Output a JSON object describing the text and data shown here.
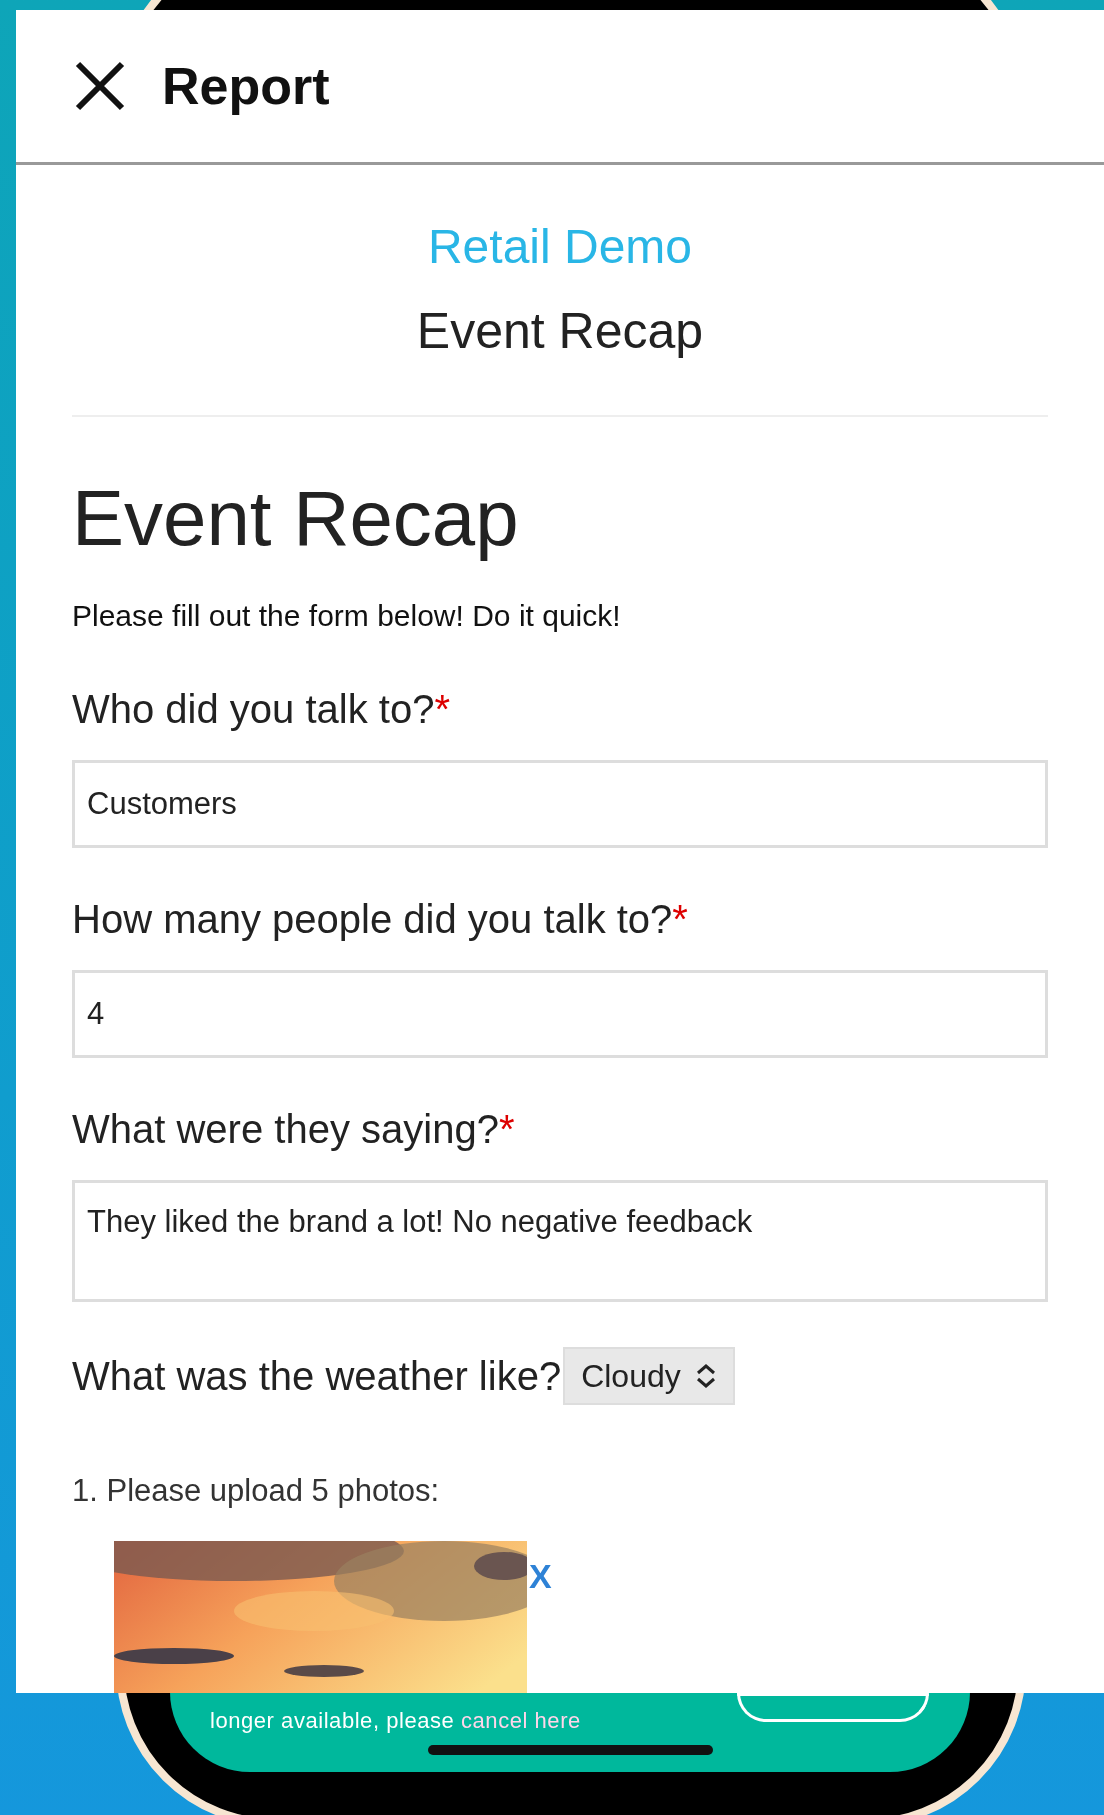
{
  "header": {
    "title": "Report"
  },
  "org": "Retail Demo",
  "form_title": "Event Recap",
  "heading": "Event Recap",
  "intro": "Please fill out the form below! Do it quick!",
  "fields": [
    {
      "kind": "text",
      "label": "Who did you talk to?",
      "required_mark": "*",
      "value": "Customers"
    },
    {
      "kind": "text",
      "label": "How many people did you talk to?",
      "required_mark": "*",
      "value": "4"
    },
    {
      "kind": "textarea",
      "label": "What were they saying?",
      "required_mark": "*",
      "value": "They liked the brand a lot! No negative feedback"
    },
    {
      "kind": "select",
      "label": "What was the weather like?",
      "value": "Cloudy"
    }
  ],
  "upload": {
    "label": "1. Please upload 5 photos:",
    "photos": [
      {
        "kind": "picture",
        "remove": "X"
      }
    ]
  },
  "banner": {
    "text": "longer available, please",
    "link": "cancel here"
  }
}
